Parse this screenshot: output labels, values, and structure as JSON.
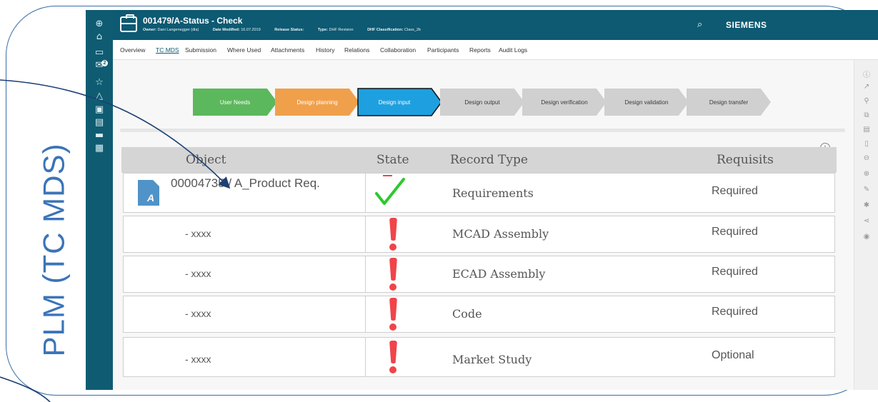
{
  "side_label": "PLM (TC MDS)",
  "header": {
    "title": "001479/A-Status - Check",
    "meta": [
      {
        "key": "Owner:",
        "value": "Dani Langenegger (dla)"
      },
      {
        "key": "Date Modified:",
        "value": "16.07.2019"
      },
      {
        "key": "Release Status:",
        "value": ""
      },
      {
        "key": "Type:",
        "value": "DHF Revision"
      },
      {
        "key": "DHF Classification:",
        "value": "Class_2b"
      }
    ],
    "brand": "SIEMENS",
    "search_icon": "search-icon"
  },
  "nav_rail": {
    "badge": "2",
    "icons": [
      "add-icon",
      "home-icon",
      "folder-icon",
      "inbox-icon",
      "star-icon",
      "alert-icon",
      "edit-icon",
      "list-icon",
      "monitor-icon",
      "report-icon"
    ]
  },
  "tabs": [
    "Overview",
    "TC MDS",
    "Submission",
    "Where Used",
    "Attachments",
    "History",
    "Relations",
    "Collaboration",
    "Participants",
    "Reports",
    "Audit Logs"
  ],
  "active_tab": "TC MDS",
  "phases": [
    {
      "label": "User Needs",
      "color": "#5cb85c"
    },
    {
      "label": "Design planning",
      "color": "#f0a04b"
    },
    {
      "label": "Design input",
      "color": "#1ea0e0"
    },
    {
      "label": "Design output",
      "color": "#d0d0d0"
    },
    {
      "label": "Design verification",
      "color": "#d0d0d0"
    },
    {
      "label": "Design validation",
      "color": "#d0d0d0"
    },
    {
      "label": "Design transfer",
      "color": "#d0d0d0"
    }
  ],
  "table": {
    "headers": {
      "object": "Object",
      "state": "State",
      "record_type": "Record Type",
      "requisits": "Requisits"
    },
    "rows": [
      {
        "object": "00004735 / A_Product Req.",
        "state": "ok",
        "record_type": "Requirements",
        "requisit": "Required"
      },
      {
        "object": "- xxxx",
        "state": "missing",
        "record_type": "MCAD Assembly",
        "requisit": "Required"
      },
      {
        "object": "- xxxx",
        "state": "missing",
        "record_type": "ECAD Assembly",
        "requisit": "Required"
      },
      {
        "object": "- xxxx",
        "state": "missing",
        "record_type": "Code",
        "requisit": "Required"
      },
      {
        "object": "- xxxx",
        "state": "missing",
        "record_type": "Market Study",
        "requisit": "Optional"
      }
    ]
  },
  "right_rail_icons": [
    "info-icon",
    "share-icon",
    "workflow-icon",
    "copy-icon",
    "paste-icon",
    "document-icon",
    "minus-circle-icon",
    "plus-circle-icon",
    "pencil-icon",
    "tools-icon",
    "network-icon",
    "eye-icon"
  ],
  "colors": {
    "brand_teal": "#0d5a72",
    "ok_green": "#2ec82e",
    "warn_red": "#f0444a",
    "frame_blue": "#3b74b8"
  }
}
